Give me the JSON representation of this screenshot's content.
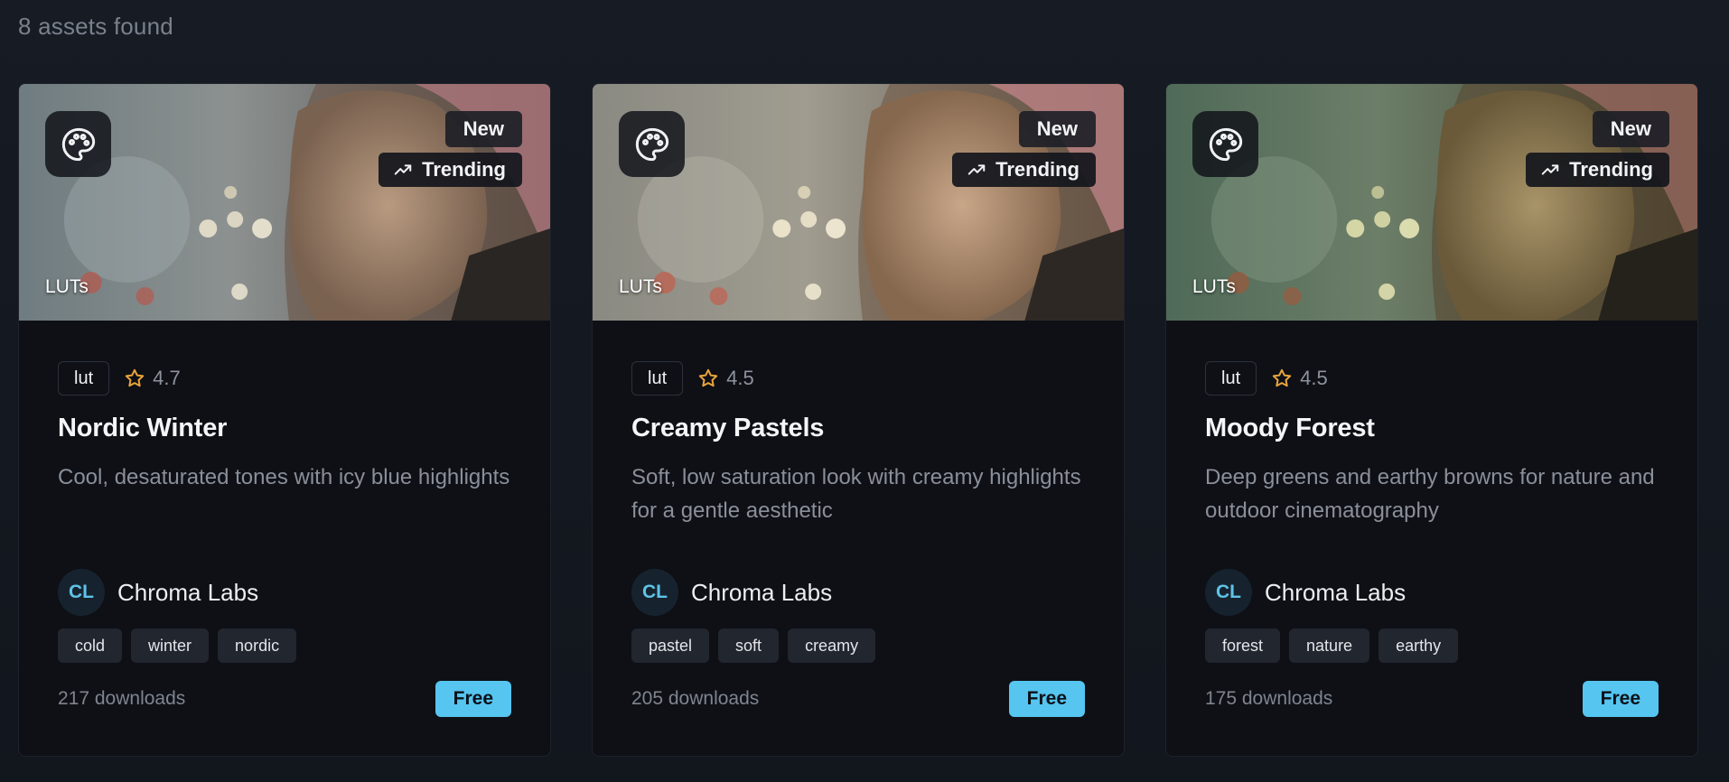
{
  "results": {
    "count_label": "8 assets found"
  },
  "colors": {
    "accent": "#56c5f0",
    "star": "#e8a53b",
    "avatar_text": "#5fc3e6"
  },
  "icons": {
    "category": "palette-icon",
    "trending": "trending-up-icon",
    "rating": "star-icon"
  },
  "cards": [
    {
      "badge_new": "New",
      "badge_trending": "Trending",
      "thumb_category": "LUTs",
      "type": "lut",
      "rating": "4.7",
      "title": "Nordic Winter",
      "description": "Cool, desaturated tones with icy blue highlights",
      "author_initials": "CL",
      "author_name": "Chroma Labs",
      "tags": [
        "cold",
        "winter",
        "nordic"
      ],
      "downloads": "217 downloads",
      "price": "Free"
    },
    {
      "badge_new": "New",
      "badge_trending": "Trending",
      "thumb_category": "LUTs",
      "type": "lut",
      "rating": "4.5",
      "title": "Creamy Pastels",
      "description": "Soft, low saturation look with creamy highlights for a gentle aesthetic",
      "author_initials": "CL",
      "author_name": "Chroma Labs",
      "tags": [
        "pastel",
        "soft",
        "creamy"
      ],
      "downloads": "205 downloads",
      "price": "Free"
    },
    {
      "badge_new": "New",
      "badge_trending": "Trending",
      "thumb_category": "LUTs",
      "type": "lut",
      "rating": "4.5",
      "title": "Moody Forest",
      "description": "Deep greens and earthy browns for nature and outdoor cinematography",
      "author_initials": "CL",
      "author_name": "Chroma Labs",
      "tags": [
        "forest",
        "nature",
        "earthy"
      ],
      "downloads": "175 downloads",
      "price": "Free"
    }
  ]
}
